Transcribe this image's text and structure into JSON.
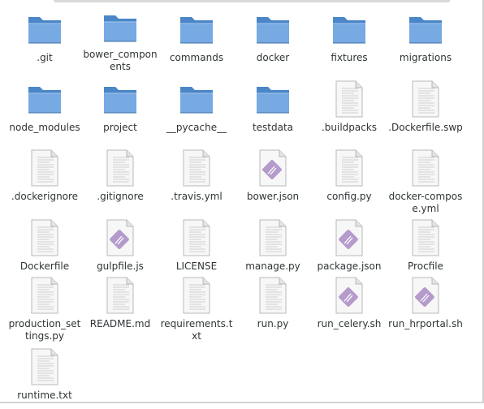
{
  "window": {
    "title": ""
  },
  "files": [
    {
      "name": ".git",
      "type": "folder"
    },
    {
      "name": "bower_components",
      "type": "folder"
    },
    {
      "name": "commands",
      "type": "folder"
    },
    {
      "name": "docker",
      "type": "folder"
    },
    {
      "name": "fixtures",
      "type": "folder"
    },
    {
      "name": "migrations",
      "type": "folder"
    },
    {
      "name": "node_modules",
      "type": "folder"
    },
    {
      "name": "project",
      "type": "folder"
    },
    {
      "name": "__pycache__",
      "type": "folder"
    },
    {
      "name": "testdata",
      "type": "folder"
    },
    {
      "name": ".buildpacks",
      "type": "text"
    },
    {
      "name": ".Dockerfile.swp",
      "type": "text"
    },
    {
      "name": ".dockerignore",
      "type": "text"
    },
    {
      "name": ".gitignore",
      "type": "text"
    },
    {
      "name": ".travis.yml",
      "type": "text"
    },
    {
      "name": "bower.json",
      "type": "script"
    },
    {
      "name": "config.py",
      "type": "text"
    },
    {
      "name": "docker-compose.yml",
      "type": "text"
    },
    {
      "name": "Dockerfile",
      "type": "text"
    },
    {
      "name": "gulpfile.js",
      "type": "script"
    },
    {
      "name": "LICENSE",
      "type": "text"
    },
    {
      "name": "manage.py",
      "type": "text"
    },
    {
      "name": "package.json",
      "type": "script"
    },
    {
      "name": "Procfile",
      "type": "text"
    },
    {
      "name": "production_settings.py",
      "type": "text"
    },
    {
      "name": "README.md",
      "type": "text"
    },
    {
      "name": "requirements.txt",
      "type": "text"
    },
    {
      "name": "run.py",
      "type": "text"
    },
    {
      "name": "run_celery.sh",
      "type": "script"
    },
    {
      "name": "run_hrportal.sh",
      "type": "script"
    },
    {
      "name": "runtime.txt",
      "type": "text"
    }
  ],
  "colors": {
    "folder_back": "#4a86c8",
    "folder_front": "#77a9e2",
    "doc_fill": "#f7f7f7",
    "doc_line": "#cfcfcf",
    "script_accent": "#a98bc4"
  }
}
